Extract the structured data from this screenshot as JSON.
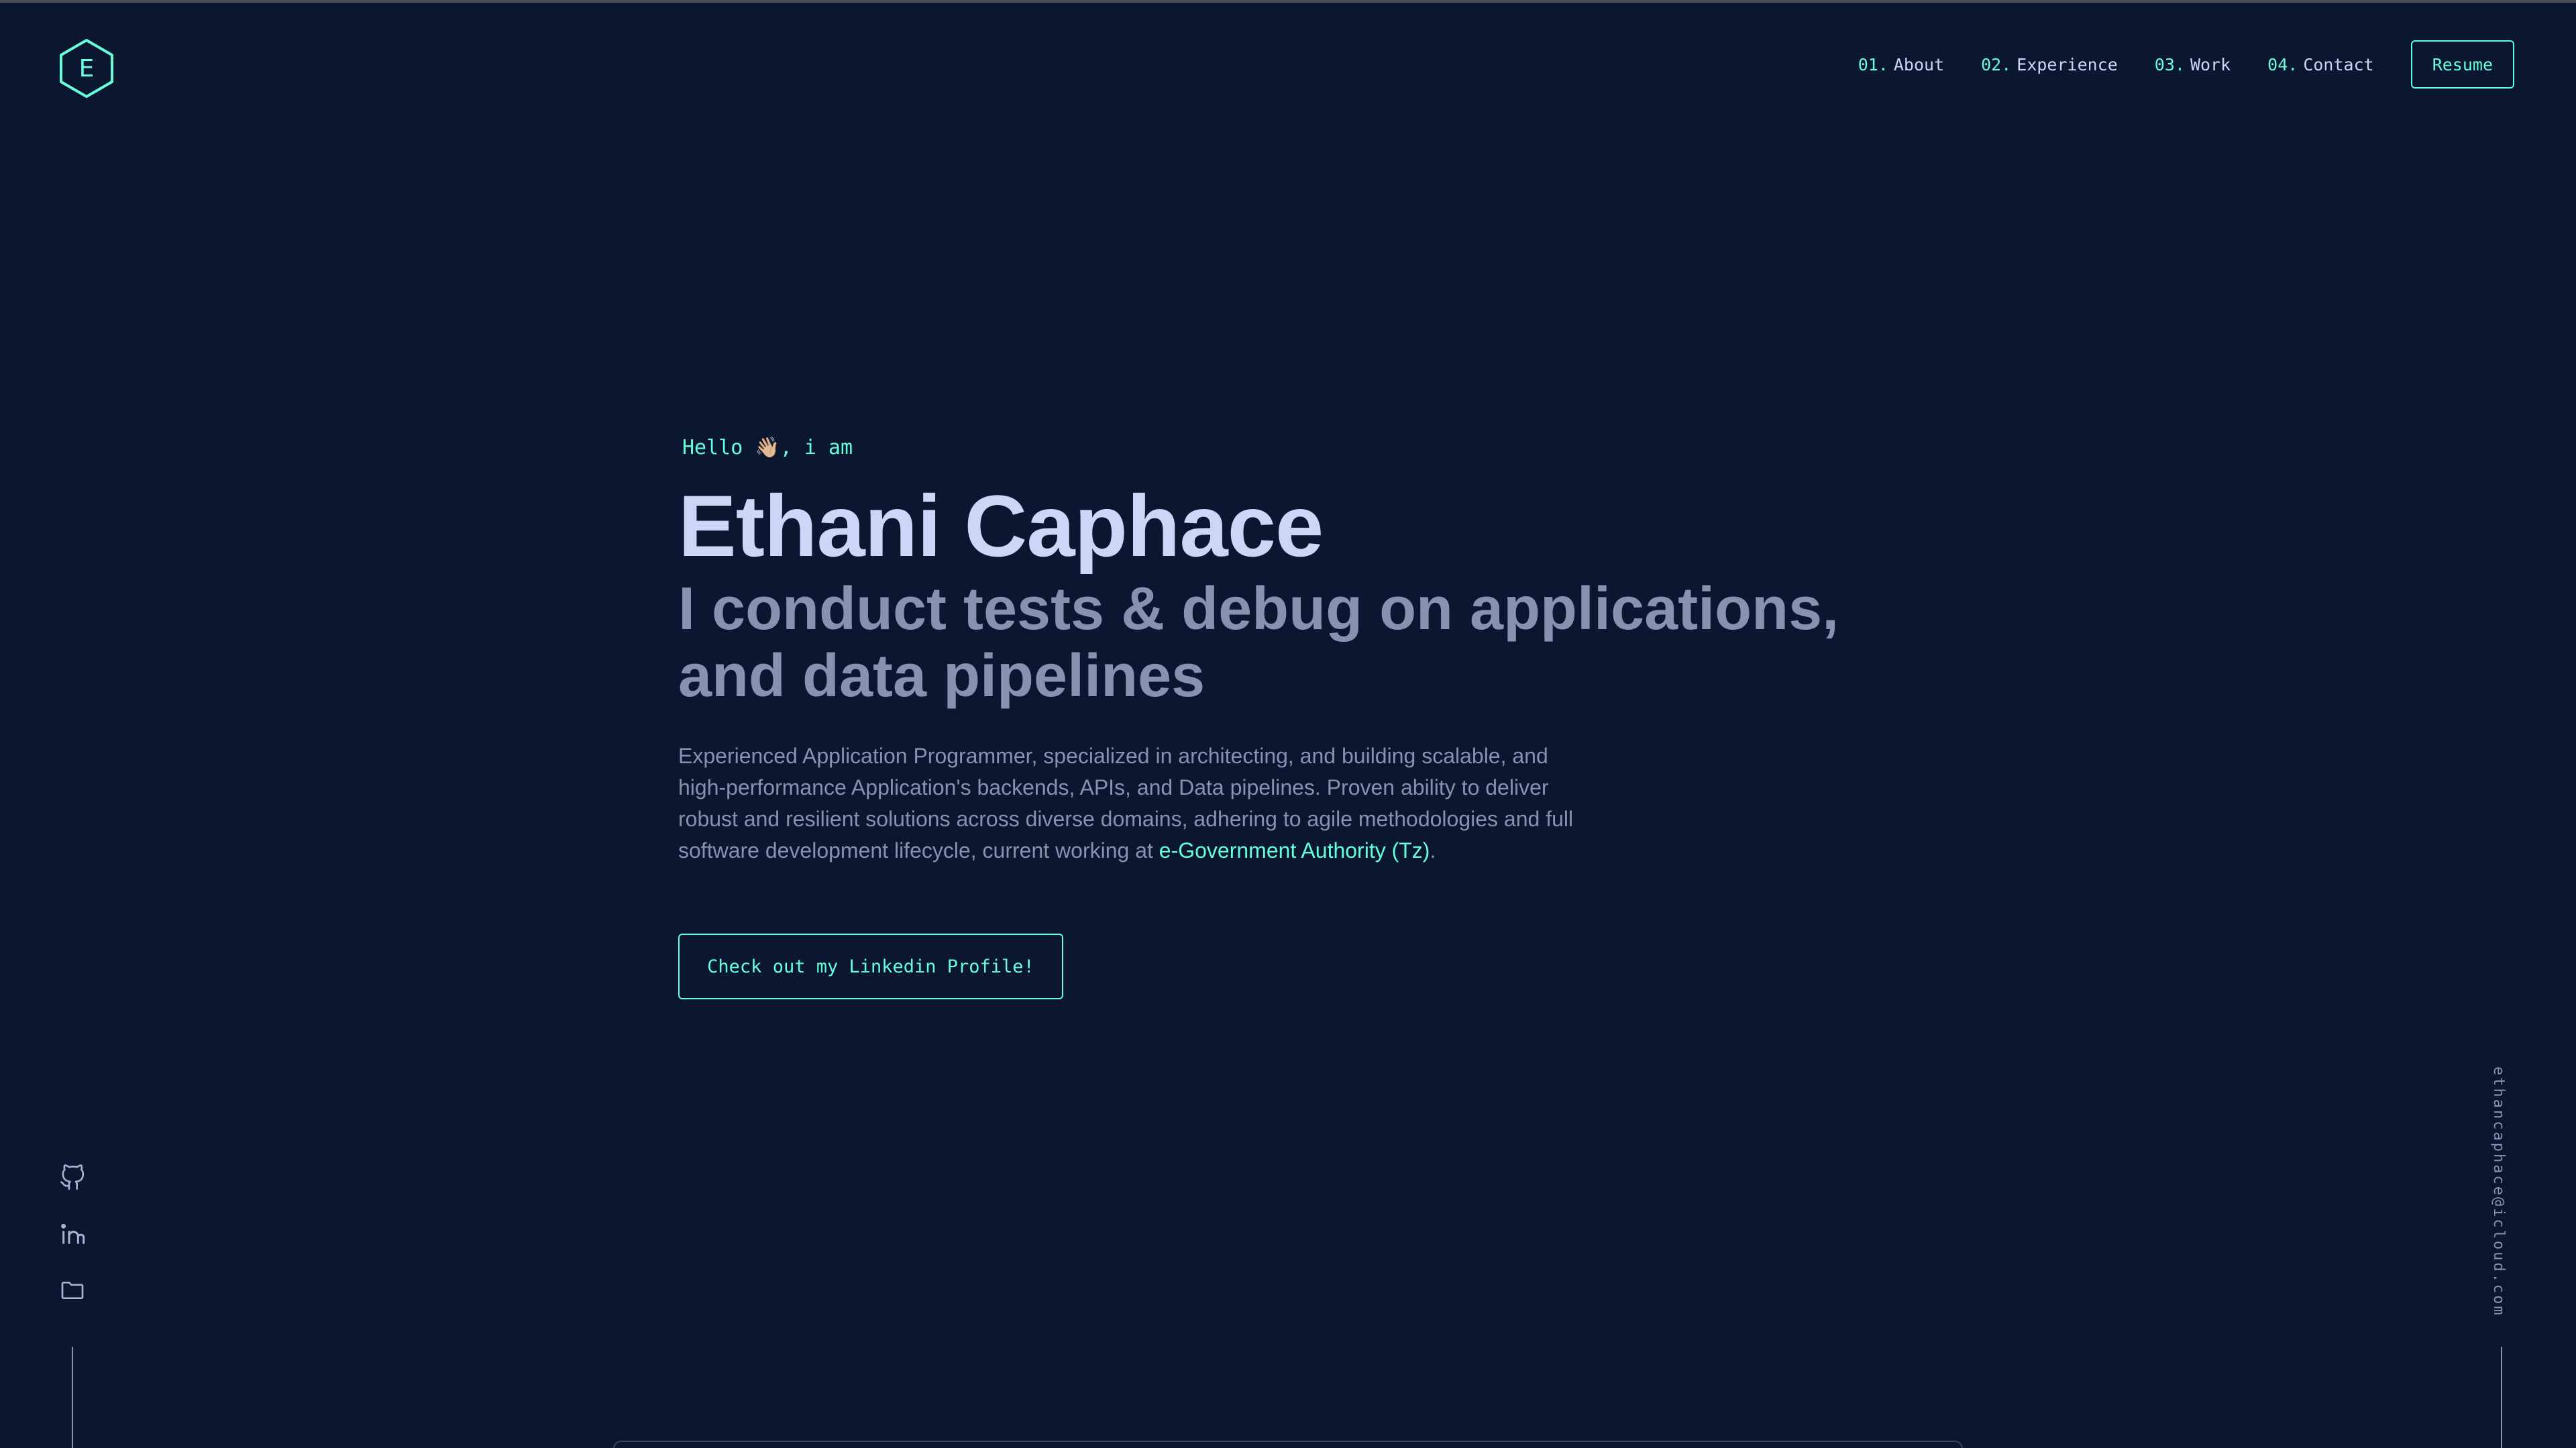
{
  "logo": {
    "letter": "E",
    "color": "#64ffda"
  },
  "nav": {
    "items": [
      {
        "num": "01.",
        "label": "About"
      },
      {
        "num": "02.",
        "label": "Experience"
      },
      {
        "num": "03.",
        "label": "Work"
      },
      {
        "num": "04.",
        "label": "Contact"
      }
    ],
    "resume_label": "Resume"
  },
  "hero": {
    "greeting": "Hello 👋🏼, i am",
    "name": "Ethani Caphace",
    "tagline": "I conduct tests & debug on applications, and data pipelines",
    "bio_text": "Experienced Application Programmer, specialized in architecting, and building scalable, and high-performance Application's backends, APIs, and Data pipelines. Proven ability to deliver robust and resilient solutions across diverse domains, adhering to agile methodologies and full software development lifecycle, current working at ",
    "bio_link": "e-Government Authority (Tz)",
    "bio_end": ".",
    "cta_label": "Check out my Linkedin Profile!"
  },
  "social": {
    "icons": [
      "github-icon",
      "linkedin-icon",
      "folder-icon"
    ]
  },
  "email": "ethancaphace@icloud.com",
  "colors": {
    "background": "#0b1730",
    "accent": "#64ffda",
    "heading": "#ccd6f6",
    "text": "#8892b0"
  }
}
